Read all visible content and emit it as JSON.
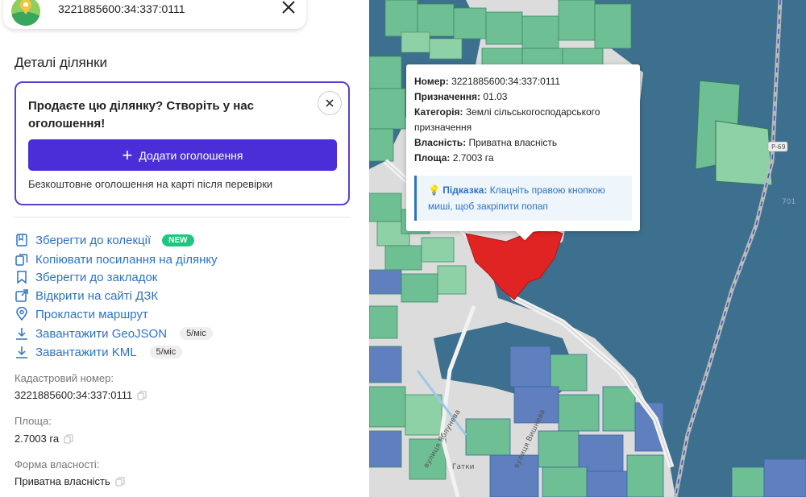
{
  "search": {
    "value": "3221885600:34:337:0111"
  },
  "details": {
    "title": "Деталі ділянки"
  },
  "promo": {
    "title": "Продаєте цю ділянку? Створіть у нас оголошення!",
    "button_label": "Додати оголошення",
    "note": "Безкоштовне оголошення на карті після перевірки"
  },
  "actions": [
    {
      "label": "Зберегти до колекції",
      "badge": "NEW",
      "icon": "collection-icon"
    },
    {
      "label": "Копіювати посилання на ділянку",
      "icon": "copy-link-icon"
    },
    {
      "label": "Зберегти до закладок",
      "icon": "bookmark-icon"
    },
    {
      "label": "Відкрити на сайті ДЗК",
      "icon": "external-link-icon"
    },
    {
      "label": "Прокласти маршрут",
      "icon": "map-pin-icon"
    },
    {
      "label": "Завантажити GeoJSON",
      "badge": "5/міс",
      "icon": "download-icon"
    },
    {
      "label": "Завантажити KML",
      "badge": "5/міс",
      "icon": "download-icon"
    }
  ],
  "fields": {
    "cadastral": {
      "label": "Кадастровий номер:",
      "value": "3221885600:34:337:0111"
    },
    "area": {
      "label": "Площа:",
      "value": "2.7003 га"
    },
    "ownership": {
      "label": "Форма власності:",
      "value": "Приватна власність"
    }
  },
  "popup": {
    "number_label": "Номер:",
    "number": "3221885600:34:337:0111",
    "purpose_label": "Призначення:",
    "purpose": "01.03",
    "category_label": "Категорія:",
    "category": "Землі сільськогосподарського призначення",
    "ownership_label": "Власність:",
    "ownership": "Приватна власність",
    "area_label": "Площа:",
    "area": "2.7003 га",
    "hint_label": "Підказка:",
    "hint": "Клацніть правою кнопкою миші, щоб закріпити попап"
  },
  "map_labels": {
    "road": "P-69",
    "num": "701",
    "street1": "вулиця Яблунева",
    "street2": "вулиця Вишнева",
    "place": "Гатки"
  },
  "colors": {
    "accent": "#4c2ed8",
    "link": "#2d72c4",
    "parcel_selected": "#e02424",
    "parcel_green": "#6fbf95",
    "parcel_blue": "#5f7fbf",
    "forest": "#3a6f8f",
    "badge_new": "#1fc77e"
  }
}
